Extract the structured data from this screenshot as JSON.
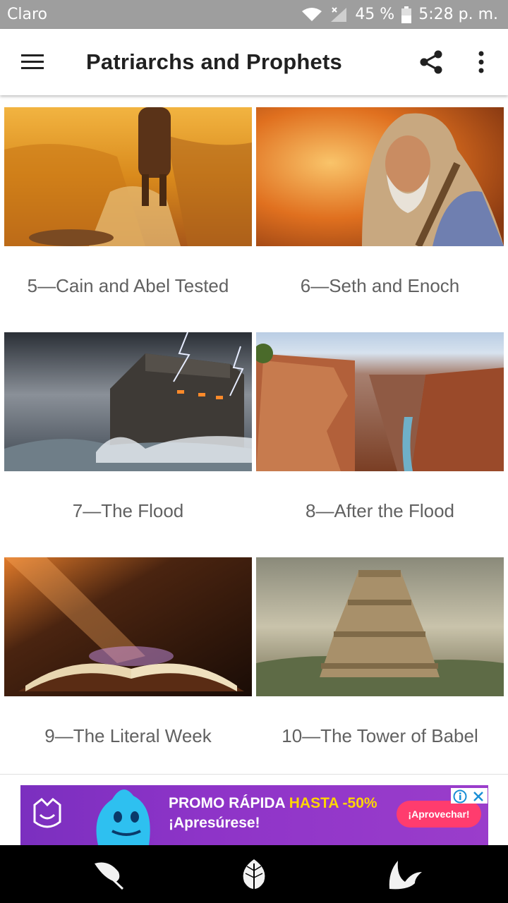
{
  "status_bar": {
    "carrier": "Claro",
    "battery": "45 %",
    "time": "5:28 p. m."
  },
  "app_bar": {
    "title": "Patriarchs and Prophets",
    "icons": [
      "menu-icon",
      "share-icon",
      "more-vert-icon"
    ]
  },
  "chapters": [
    {
      "label": "5—Cain and Abel Tested",
      "image": "cain-abel-image"
    },
    {
      "label": "6—Seth and Enoch",
      "image": "seth-enoch-image"
    },
    {
      "label": "7—The Flood",
      "image": "flood-image"
    },
    {
      "label": "8—After the Flood",
      "image": "after-flood-image"
    },
    {
      "label": "9—The Literal Week",
      "image": "literal-week-image"
    },
    {
      "label": "10—The Tower of Babel",
      "image": "tower-babel-image"
    }
  ],
  "ad": {
    "line1_prefix": "PROMO RÁPIDA ",
    "line1_highlight": "HASTA -50%",
    "line2": "¡Apresúrese!",
    "cta": "¡Aprovechar!"
  },
  "bottom_nav": {
    "icons": [
      "feather-icon",
      "leaf-icon",
      "wings-icon"
    ]
  }
}
